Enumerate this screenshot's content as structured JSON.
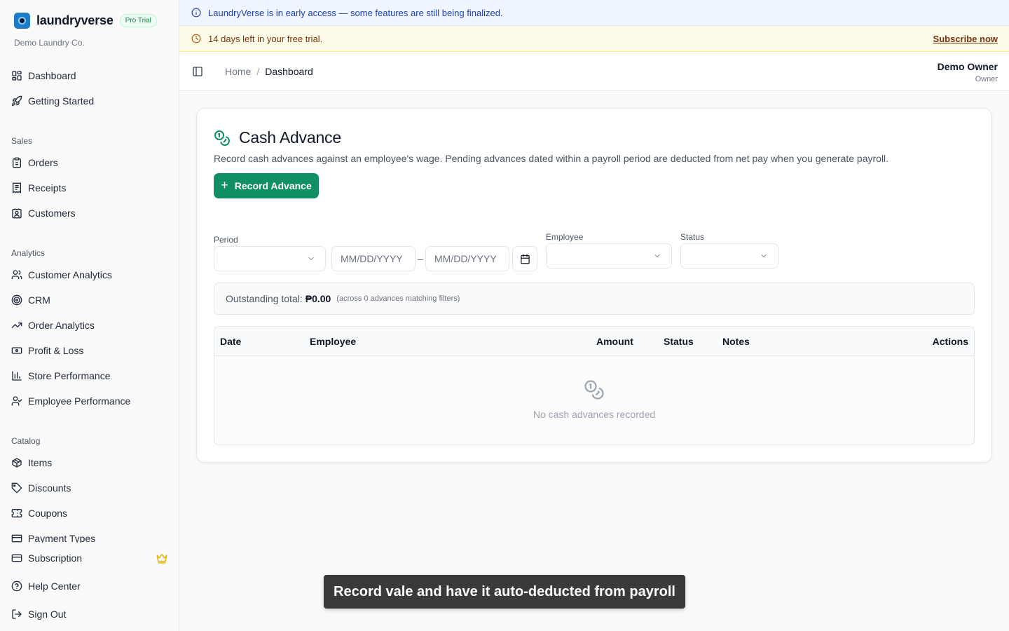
{
  "brand": {
    "name": "laundryverse",
    "badge": "Pro Trial",
    "org": "Demo Laundry Co."
  },
  "sidebar": {
    "top": [
      {
        "label": "Dashboard",
        "icon": "dashboard-icon"
      },
      {
        "label": "Getting Started",
        "icon": "rocket-icon"
      }
    ],
    "sections": [
      {
        "title": "Sales",
        "items": [
          {
            "label": "Orders",
            "icon": "clipboard-icon"
          },
          {
            "label": "Receipts",
            "icon": "receipt-icon"
          },
          {
            "label": "Customers",
            "icon": "contact-icon"
          }
        ]
      },
      {
        "title": "Analytics",
        "items": [
          {
            "label": "Customer Analytics",
            "icon": "users-icon"
          },
          {
            "label": "CRM",
            "icon": "target-icon"
          },
          {
            "label": "Order Analytics",
            "icon": "trending-up-icon"
          },
          {
            "label": "Profit & Loss",
            "icon": "banknote-icon"
          },
          {
            "label": "Store Performance",
            "icon": "bar-chart-icon"
          },
          {
            "label": "Employee Performance",
            "icon": "user-check-icon"
          }
        ]
      },
      {
        "title": "Catalog",
        "items": [
          {
            "label": "Items",
            "icon": "package-icon"
          },
          {
            "label": "Discounts",
            "icon": "tag-icon"
          },
          {
            "label": "Coupons",
            "icon": "ticket-icon"
          },
          {
            "label": "Payment Types",
            "icon": "credit-card-icon"
          }
        ]
      }
    ],
    "bottom": [
      {
        "label": "Subscription",
        "icon": "credit-card-icon"
      },
      {
        "label": "Help Center",
        "icon": "help-circle-icon"
      },
      {
        "label": "Sign Out",
        "icon": "log-out-icon"
      }
    ]
  },
  "banners": {
    "info": "LaundryVerse is in early access — some features are still being finalized.",
    "trial": "14 days left in your free trial.",
    "subscribe": "Subscribe now"
  },
  "header": {
    "breadcrumb": [
      "Home",
      "Dashboard"
    ],
    "user_name": "Demo Owner",
    "user_role": "Owner"
  },
  "page": {
    "title": "Cash Advance",
    "description": "Record cash advances against an employee's wage. Pending advances dated within a payroll period are deducted from net pay when you generate payroll.",
    "record_button": "Record Advance",
    "filters": {
      "period_label": "Period",
      "period_value": "",
      "date_from_placeholder": "MM/DD/YYYY",
      "date_to_placeholder": "MM/DD/YYYY",
      "date_separator": "–",
      "employee_label": "Employee",
      "employee_value": "",
      "status_label": "Status",
      "status_value": ""
    },
    "summary": {
      "label": "Outstanding total:",
      "amount": "₱0.00",
      "note": "(across 0 advances matching filters)"
    },
    "table": {
      "columns": [
        "Date",
        "Employee",
        "Amount",
        "Status",
        "Notes",
        "Actions"
      ],
      "rows": [],
      "empty_text": "No cash advances recorded"
    }
  },
  "toast": "Record vale and have it auto-deducted from payroll",
  "colors": {
    "primary": "#0f8f63",
    "info_bg": "#eff6ff",
    "trial_bg": "#fefce8",
    "crown": "#eab308"
  }
}
